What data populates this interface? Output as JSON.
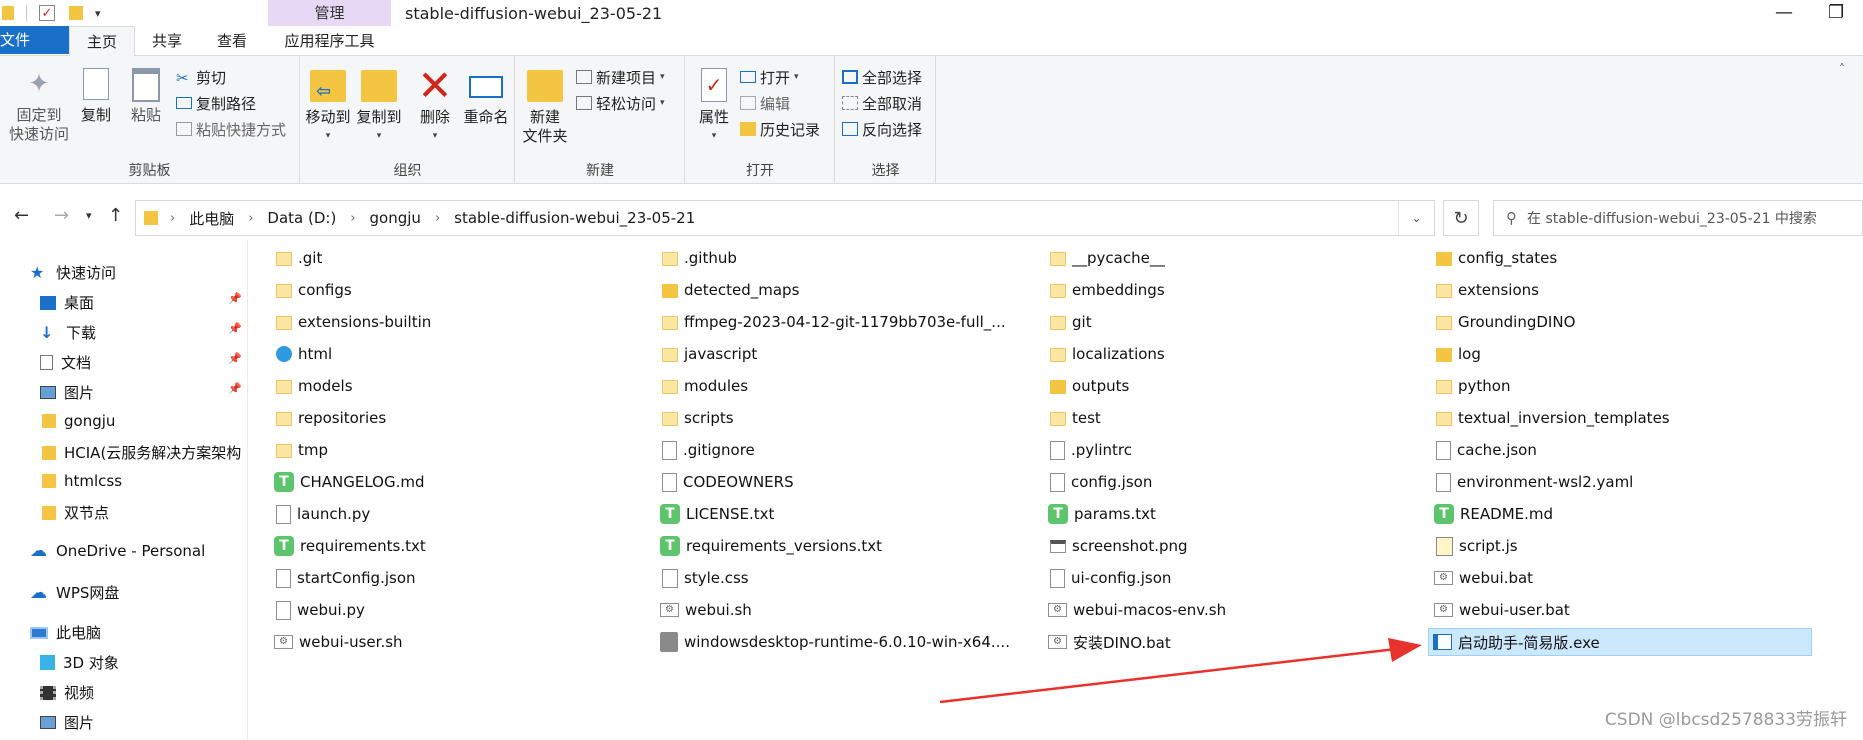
{
  "window": {
    "manage_tab": "管理",
    "title": "stable-diffusion-webui_23-05-21",
    "minimize": "—",
    "restore": "❐"
  },
  "tabs": {
    "file": "文件",
    "home": "主页",
    "share": "共享",
    "view": "查看",
    "app_tools": "应用程序工具"
  },
  "ribbon": {
    "clipboard": {
      "label": "剪贴板",
      "pin_line1": "固定到",
      "pin_line2": "快速访问",
      "copy": "复制",
      "paste": "粘贴",
      "cut": "剪切",
      "copy_path": "复制路径",
      "paste_shortcut": "粘贴快捷方式"
    },
    "organize": {
      "label": "组织",
      "move_to": "移动到",
      "copy_to": "复制到",
      "delete": "删除",
      "rename": "重命名"
    },
    "new": {
      "label": "新建",
      "new_folder_line1": "新建",
      "new_folder_line2": "文件夹",
      "new_item": "新建项目",
      "easy_access": "轻松访问"
    },
    "open": {
      "label": "打开",
      "properties": "属性",
      "open": "打开",
      "edit": "编辑",
      "history": "历史记录"
    },
    "select": {
      "label": "选择",
      "select_all": "全部选择",
      "select_none": "全部取消",
      "invert": "反向选择"
    }
  },
  "address": {
    "crumbs": [
      "此电脑",
      "Data (D:)",
      "gongju",
      "stable-diffusion-webui_23-05-21"
    ],
    "search_placeholder": "在 stable-diffusion-webui_23-05-21 中搜索"
  },
  "nav": {
    "quick_access": "快速访问",
    "desktop": "桌面",
    "downloads": "下载",
    "documents": "文档",
    "pictures": "图片",
    "gongju": "gongju",
    "hcia": "HCIA(云服务解决方案架构",
    "htmlcss": "htmlcss",
    "festival": "双节点",
    "onedrive": "OneDrive - Personal",
    "wps": "WPS网盘",
    "this_pc": "此电脑",
    "objects3d": "3D 对象",
    "videos": "视频",
    "pictures2": "图片"
  },
  "files": {
    "col1": [
      ".git",
      "configs",
      "extensions-builtin",
      "html",
      "models",
      "repositories",
      "tmp",
      "CHANGELOG.md",
      "launch.py",
      "requirements.txt",
      "startConfig.json",
      "webui.py",
      "webui-user.sh"
    ],
    "col2": [
      ".github",
      "detected_maps",
      "ffmpeg-2023-04-12-git-1179bb703e-full_...",
      "javascript",
      "modules",
      "scripts",
      ".gitignore",
      "CODEOWNERS",
      "LICENSE.txt",
      "requirements_versions.txt",
      "style.css",
      "webui.sh",
      "windowsdesktop-runtime-6.0.10-win-x64...."
    ],
    "col3": [
      "__pycache__",
      "embeddings",
      "git",
      "localizations",
      "outputs",
      "test",
      ".pylintrc",
      "config.json",
      "params.txt",
      "screenshot.png",
      "ui-config.json",
      "webui-macos-env.sh",
      "安装DINO.bat"
    ],
    "col4": [
      "config_states",
      "extensions",
      "GroundingDINO",
      "log",
      "python",
      "textual_inversion_templates",
      "cache.json",
      "environment-wsl2.yaml",
      "README.md",
      "script.js",
      "webui.bat",
      "webui-user.bat",
      "启动助手-简易版.exe"
    ]
  },
  "watermark": "CSDN @lbcsd2578833劳振轩"
}
